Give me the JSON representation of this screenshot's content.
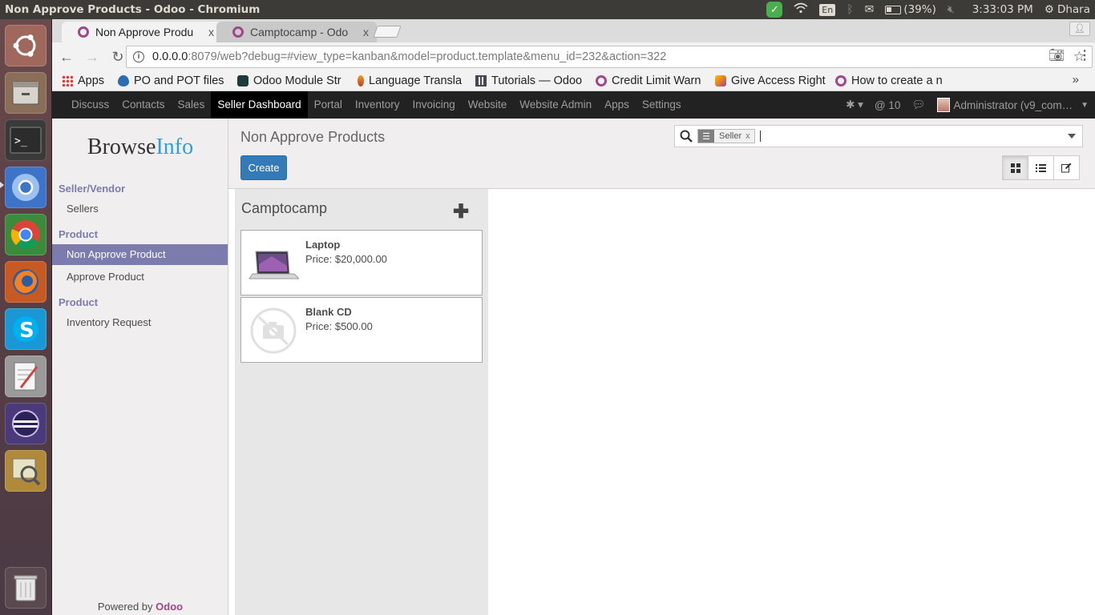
{
  "os": {
    "window_title": "Non Approve Products - Odoo - Chromium",
    "battery": "(39%)",
    "clock": "3:33:03 PM",
    "user": "Dhara",
    "keyboard_layout": "En"
  },
  "browser": {
    "tabs": [
      {
        "title": "Non Approve Produ",
        "active": true
      },
      {
        "title": "Camptocamp - Odo",
        "active": false
      }
    ],
    "tab_close": "x",
    "url_host": "0.0.0.0",
    "url_rest": ":8079/web?debug=#view_type=kanban&model=product.template&menu_id=232&action=322",
    "bookmarks": [
      {
        "label": "Apps",
        "icon": "apps-grid-icon"
      },
      {
        "label": "PO and POT files",
        "icon": "drupal-icon"
      },
      {
        "label": "Odoo Module Str",
        "icon": "odoo-module-icon"
      },
      {
        "label": "Language Transla",
        "icon": "language-icon"
      },
      {
        "label": "Tutorials — Odoo",
        "icon": "tutorials-icon"
      },
      {
        "label": "Credit Limit Warn",
        "icon": "odoo-circle-icon"
      },
      {
        "label": "Give Access Right",
        "icon": "access-icon"
      },
      {
        "label": "How to create a n",
        "icon": "odoo-circle-icon"
      }
    ],
    "bookmarks_more": "»"
  },
  "odoo": {
    "menu": [
      "Discuss",
      "Contacts",
      "Sales",
      "Seller Dashboard",
      "Portal",
      "Inventory",
      "Invoicing",
      "Website",
      "Website Admin",
      "Apps",
      "Settings"
    ],
    "active_menu_index": 3,
    "mentions_count": "@ 10",
    "user_label": "Administrator (v9_com…",
    "logo_part1": "Browse",
    "logo_part2": "Info",
    "sidebar": {
      "section_seller": "Seller/Vendor",
      "sellers": "Sellers",
      "section_product_1": "Product",
      "non_approve": "Non Approve Product",
      "approve": "Approve Product",
      "section_product_2": "Product",
      "inventory_request": "Inventory Request"
    },
    "powered_by": "Powered by",
    "powered_brand": "Odoo",
    "breadcrumb": "Non Approve Products",
    "create_label": "Create",
    "search_facet": "Seller",
    "search_facet_close": "x",
    "kanban": {
      "column_title": "Camptocamp",
      "column_add": "✚",
      "cards": [
        {
          "name": "Laptop",
          "price": "Price: $20,000.00",
          "image": "laptop-image"
        },
        {
          "name": "Blank CD",
          "price": "Price: $500.00",
          "image": "no-image-placeholder"
        }
      ]
    }
  },
  "colors": {
    "odoo_primary": "#7c7bad",
    "odoo_brand": "#a24689",
    "create_button": "#337ab7",
    "navbar": "#222222"
  }
}
